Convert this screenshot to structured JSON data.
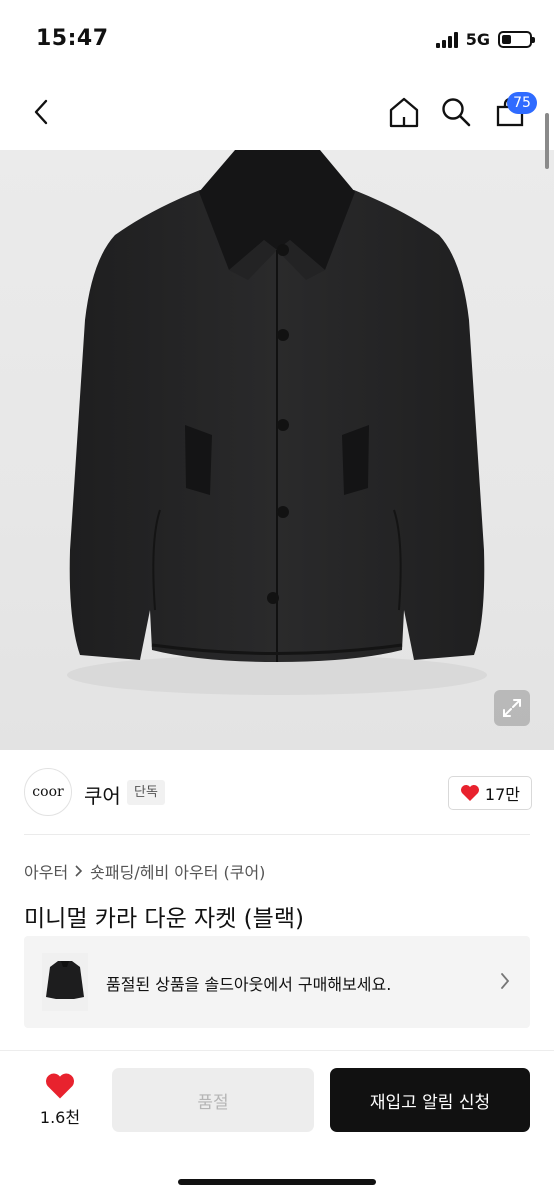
{
  "status_bar": {
    "time": "15:47",
    "network": "5G",
    "battery_level": 0.35
  },
  "nav": {
    "back_icon": "chevron-left-icon",
    "home_icon": "home-icon",
    "search_icon": "search-icon",
    "cart_icon": "shopping-bag-icon",
    "cart_count": "75"
  },
  "product_image": {
    "expand_icon": "expand-icon"
  },
  "brand": {
    "logo_text": "coor",
    "name": "쿠어",
    "tag": "단독",
    "likes": "17만"
  },
  "breadcrumb": {
    "category": "아우터",
    "subcategory": "숏패딩/헤비 아우터 (쿠어)"
  },
  "product": {
    "title": "미니멀 카라 다운 자켓 (블랙)"
  },
  "soldout_banner": {
    "text": "품절된 상품을 솔드아웃에서 구매해보세요."
  },
  "bottom_bar": {
    "wish_count": "1.6천",
    "soldout_label": "품절",
    "restock_label": "재입고 알림 신청"
  },
  "colors": {
    "accent_blue": "#2f6bff",
    "heart_red": "#e8222e",
    "primary_button": "#111111"
  }
}
